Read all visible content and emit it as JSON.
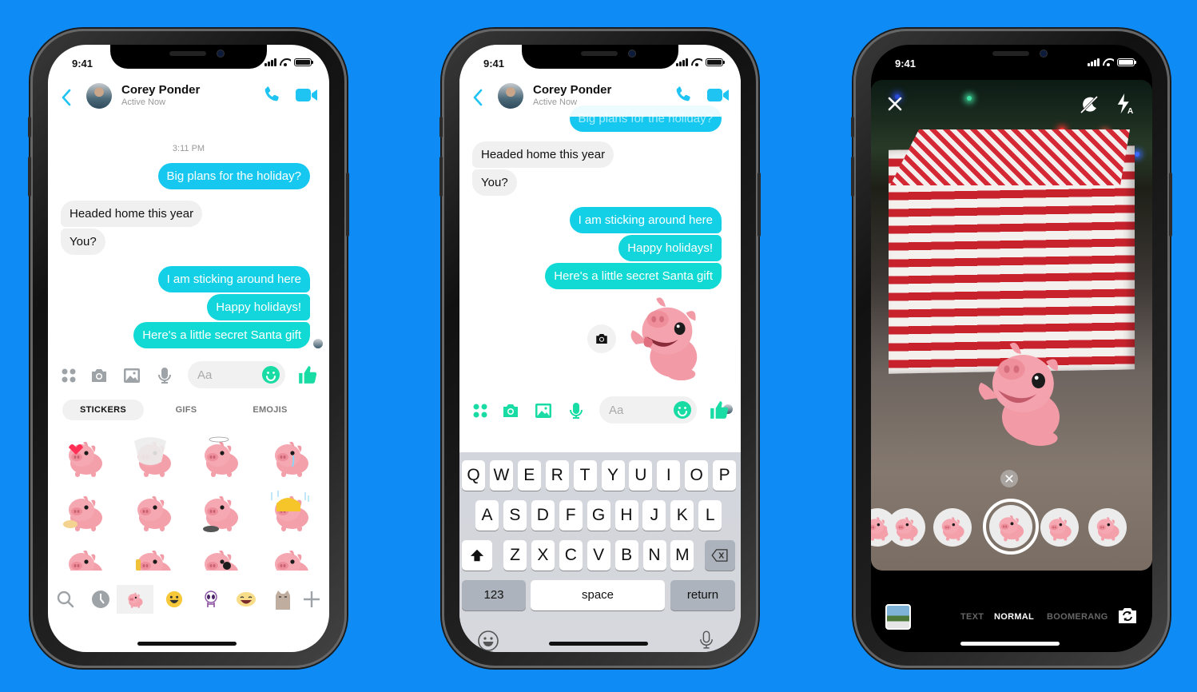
{
  "colors": {
    "background": "#0f8bf5",
    "messenger_blue": "#1fc4f2",
    "messenger_teal": "#12d9d0",
    "incoming_bubble": "#f0f0f0",
    "action_green": "#19dca5",
    "icon_gray": "#9ea3a8"
  },
  "phone1": {
    "status": {
      "time": "9:41"
    },
    "header": {
      "back_icon": "chevron-left-icon",
      "contact_name": "Corey Ponder",
      "presence": "Active Now",
      "call_icon": "phone-icon",
      "video_icon": "video-camera-icon"
    },
    "timestamp": "3:11 PM",
    "messages": [
      {
        "dir": "out",
        "text": "Big plans for the holiday?"
      },
      {
        "dir": "in",
        "text": "Headed home this year"
      },
      {
        "dir": "in",
        "text": "You?"
      },
      {
        "dir": "out",
        "text": "I am sticking around here"
      },
      {
        "dir": "out",
        "text": "Happy holidays!"
      },
      {
        "dir": "out",
        "text": "Here's a little secret Santa gift"
      }
    ],
    "composer": {
      "placeholder": "Aa",
      "icons": [
        "apps-icon",
        "camera-icon",
        "photo-icon",
        "microphone-icon",
        "emoji-icon",
        "thumbs-up-icon"
      ]
    },
    "tabs": [
      {
        "label": "STICKERS",
        "selected": true
      },
      {
        "label": "GIFS",
        "selected": false
      },
      {
        "label": "EMOJIS",
        "selected": false
      }
    ],
    "stickers": [
      "pig-heart-eyes",
      "pig-cone-collar",
      "pig-dizzy",
      "pig-crying",
      "pig-donuts",
      "pig-winking",
      "pig-eating-noodles",
      "pig-raincoat",
      "pig-laughing",
      "pig-lying-drink",
      "pig-big-eyes",
      "pig-running"
    ],
    "sticker_tray": [
      "search-icon",
      "recent-clock-icon",
      "pig-pack-icon",
      "smiley-pack-icon",
      "alien-pack-icon",
      "laughing-pack-icon",
      "pusheen-pack-icon",
      "add-icon"
    ]
  },
  "phone2": {
    "status": {
      "time": "9:41"
    },
    "header": {
      "contact_name": "Corey Ponder",
      "presence": "Active Now"
    },
    "partial_message": "Big plans for the holiday?",
    "messages": [
      {
        "dir": "in",
        "text": "Headed home this year"
      },
      {
        "dir": "in",
        "text": "You?"
      },
      {
        "dir": "out",
        "text": "I am sticking around here"
      },
      {
        "dir": "out",
        "text": "Happy holidays!"
      },
      {
        "dir": "out",
        "text": "Here's a little secret Santa gift"
      }
    ],
    "sticker_message": "pig-waving",
    "composer": {
      "placeholder": "Aa"
    },
    "keyboard": {
      "row1": [
        "Q",
        "W",
        "E",
        "R",
        "T",
        "Y",
        "U",
        "I",
        "O",
        "P"
      ],
      "row2": [
        "A",
        "S",
        "D",
        "F",
        "G",
        "H",
        "J",
        "K",
        "L"
      ],
      "row3": [
        "Z",
        "X",
        "C",
        "V",
        "B",
        "N",
        "M"
      ],
      "numbers_label": "123",
      "space_label": "space",
      "return_label": "return"
    }
  },
  "phone3": {
    "status": {
      "time": "9:41"
    },
    "modes": [
      {
        "label": "TEXT",
        "selected": false
      },
      {
        "label": "NORMAL",
        "selected": true
      },
      {
        "label": "BOOMERANG",
        "selected": false
      }
    ],
    "carousel": [
      "pig-lying",
      "pig-dizzy-stars",
      "pig-waving",
      "pig-tongue",
      "pig-sneaky"
    ],
    "selected_sticker": "pig-waving"
  }
}
